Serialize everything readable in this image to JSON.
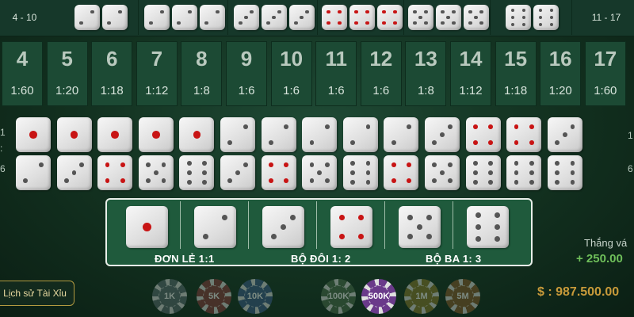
{
  "top_row": {
    "left_range": "4 - 10",
    "right_range": "11 - 17",
    "triples": [
      {
        "faces": [
          2,
          2
        ]
      },
      {
        "faces": [
          2,
          2,
          2
        ]
      },
      {
        "faces": [
          3,
          3,
          3
        ]
      },
      {
        "faces": [
          4,
          4,
          4
        ]
      },
      {
        "faces": [
          5,
          5,
          5
        ]
      },
      {
        "faces": [
          6,
          6
        ]
      }
    ]
  },
  "totals": [
    {
      "total": "4",
      "odds": "1:60"
    },
    {
      "total": "5",
      "odds": "1:20"
    },
    {
      "total": "6",
      "odds": "1:18"
    },
    {
      "total": "7",
      "odds": "1:12"
    },
    {
      "total": "8",
      "odds": "1:8"
    },
    {
      "total": "9",
      "odds": "1:6"
    },
    {
      "total": "10",
      "odds": "1:6"
    },
    {
      "total": "11",
      "odds": "1:6"
    },
    {
      "total": "12",
      "odds": "1:6"
    },
    {
      "total": "13",
      "odds": "1:8"
    },
    {
      "total": "14",
      "odds": "1:12"
    },
    {
      "total": "15",
      "odds": "1:18"
    },
    {
      "total": "16",
      "odds": "1:20"
    },
    {
      "total": "17",
      "odds": "1:60"
    }
  ],
  "pairs_top": [
    1,
    1,
    1,
    1,
    1,
    2,
    2,
    2,
    2,
    2,
    3,
    4,
    4,
    3
  ],
  "pairs_bottom": [
    2,
    3,
    4,
    5,
    6,
    3,
    4,
    5,
    6,
    4,
    5,
    6,
    6,
    6
  ],
  "side_left": [
    "1",
    ":",
    "6"
  ],
  "side_right": [
    "1",
    "6"
  ],
  "bet_panel": {
    "dice": [
      1,
      2,
      3,
      4,
      5,
      6
    ],
    "single_label": "ĐƠN LẺ 1:1",
    "double_label": "BỘ ĐÔI 1: 2",
    "triple_label": "BỘ BA 1: 3"
  },
  "history_button": "Lịch sử Tài Xỉu",
  "chips": [
    {
      "label": "1K",
      "color": "#5a6a70"
    },
    {
      "label": "5K",
      "color": "#8a3a3a"
    },
    {
      "label": "10K",
      "color": "#3a5a8a"
    },
    {
      "label": "100K",
      "color": "#4a6a4a"
    },
    {
      "label": "500K",
      "color": "#6a3a8a",
      "active": true
    },
    {
      "label": "1M",
      "color": "#8a7a2a"
    },
    {
      "label": "5M",
      "color": "#8a5a2a"
    }
  ],
  "win": {
    "label": "Thắng vá",
    "value": "+ 250.00"
  },
  "balance": "$ : 987.500.00",
  "colors": {
    "felt": "#1c4a34",
    "pip_red": "#c81414",
    "win_green": "#6fbf5a",
    "gold": "#c89a3a"
  }
}
